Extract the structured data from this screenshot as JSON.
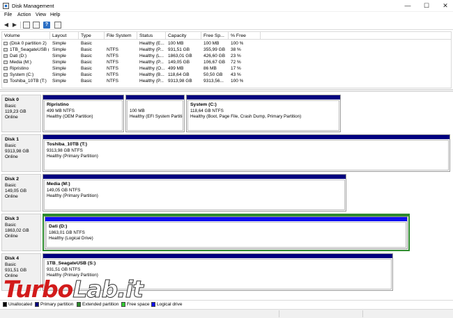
{
  "window": {
    "title": "Disk Management",
    "controls": {
      "minimize": "—",
      "maximize": "☐",
      "close": "✕"
    }
  },
  "menu": [
    "File",
    "Action",
    "View",
    "Help"
  ],
  "toolbar": {
    "icons": [
      "back-arrow-icon",
      "forward-arrow-icon",
      "console-tree-icon",
      "properties-icon",
      "help-icon",
      "show-hide-icon"
    ]
  },
  "volume_list": {
    "columns": [
      "Volume",
      "Layout",
      "Type",
      "File System",
      "Status",
      "Capacity",
      "Free Sp...",
      "% Free"
    ],
    "rows": [
      [
        "(Disk 0 partition 2)",
        "Simple",
        "Basic",
        "",
        "Healthy (E...",
        "100 MB",
        "100 MB",
        "100 %"
      ],
      [
        "1TB_SeagateUSB (...",
        "Simple",
        "Basic",
        "NTFS",
        "Healthy (P...",
        "931,51 GB",
        "355,99 GB",
        "38 %"
      ],
      [
        "Dati (D:)",
        "Simple",
        "Basic",
        "NTFS",
        "Healthy (L...",
        "1863,01 GB",
        "426,60 GB",
        "23 %"
      ],
      [
        "Media (M:)",
        "Simple",
        "Basic",
        "NTFS",
        "Healthy (P...",
        "149,05 GB",
        "106,67 GB",
        "72 %"
      ],
      [
        "Ripristino",
        "Simple",
        "Basic",
        "NTFS",
        "Healthy (O...",
        "499 MB",
        "86 MB",
        "17 %"
      ],
      [
        "System (C:)",
        "Simple",
        "Basic",
        "NTFS",
        "Healthy (B...",
        "118,64 GB",
        "50,50 GB",
        "43 %"
      ],
      [
        "Toshiba_10TB (T:)",
        "Simple",
        "Basic",
        "NTFS",
        "Healthy (P...",
        "9313,98 GB",
        "9313,56...",
        "100 %"
      ]
    ]
  },
  "disks": [
    {
      "name": "Disk 0",
      "type": "Basic",
      "size": "119,23 GB",
      "status": "Online",
      "partitions": [
        {
          "name": "Ripristino",
          "size": "499 MB NTFS",
          "status": "Healthy (OEM Partition)"
        },
        {
          "name": "",
          "size": "100 MB",
          "status": "Healthy (EFI System Partition)"
        },
        {
          "name": "System  (C:)",
          "size": "118,64 GB NTFS",
          "status": "Healthy (Boot, Page File, Crash Dump, Primary Partition)"
        }
      ]
    },
    {
      "name": "Disk 1",
      "type": "Basic",
      "size": "9313,98 GB",
      "status": "Online",
      "partitions": [
        {
          "name": "Toshiba_10TB  (T:)",
          "size": "9313,98 GB NTFS",
          "status": "Healthy (Primary Partition)"
        }
      ]
    },
    {
      "name": "Disk 2",
      "type": "Basic",
      "size": "149,05 GB",
      "status": "Online",
      "partitions": [
        {
          "name": "Media  (M:)",
          "size": "149,05 GB NTFS",
          "status": "Healthy (Primary Partition)"
        }
      ]
    },
    {
      "name": "Disk 3",
      "type": "Basic",
      "size": "1863,02 GB",
      "status": "Online",
      "partitions": [
        {
          "name": "Dati  (D:)",
          "size": "1863,01 GB NTFS",
          "status": "Healthy (Logical Drive)"
        }
      ]
    },
    {
      "name": "Disk 4",
      "type": "Basic",
      "size": "931,51 GB",
      "status": "Online",
      "partitions": [
        {
          "name": "1TB_SeagateUSB  (S:)",
          "size": "931,51 GB NTFS",
          "status": "Healthy (Primary Partition)"
        }
      ]
    }
  ],
  "legend": [
    {
      "label": "Unallocated",
      "color": "#000000"
    },
    {
      "label": "Primary partition",
      "color": "#00007f"
    },
    {
      "label": "Extended partition",
      "color": "#2e8b2e"
    },
    {
      "label": "Free space",
      "color": "#33cc33"
    },
    {
      "label": "Logical drive",
      "color": "#1010f0"
    }
  ],
  "watermark": {
    "part1": "Turbo",
    "part2": "Lab.it"
  }
}
